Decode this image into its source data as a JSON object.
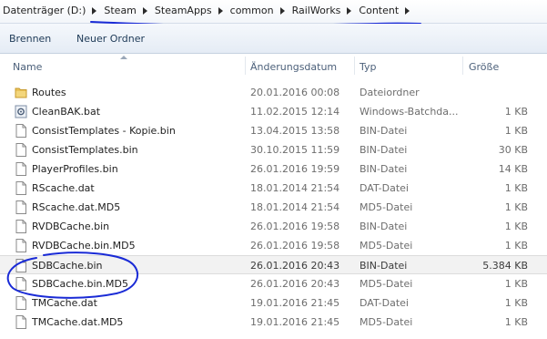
{
  "breadcrumb": {
    "items": [
      {
        "label": "Datenträger (D:)"
      },
      {
        "label": "Steam"
      },
      {
        "label": "SteamApps"
      },
      {
        "label": "common"
      },
      {
        "label": "RailWorks"
      },
      {
        "label": "Content"
      }
    ]
  },
  "toolbar": {
    "burn_label": "Brennen",
    "new_folder_label": "Neuer Ordner"
  },
  "columns": {
    "name": "Name",
    "date": "Änderungsdatum",
    "type": "Typ",
    "size": "Größe"
  },
  "files": [
    {
      "name": "Routes",
      "date": "20.01.2016 00:08",
      "type": "Dateiordner",
      "size": "",
      "icon": "folder-icon"
    },
    {
      "name": "CleanBAK.bat",
      "date": "11.02.2015 12:14",
      "type": "Windows-Batchda...",
      "size": "1 KB",
      "icon": "batch-file-icon"
    },
    {
      "name": "ConsistTemplates - Kopie.bin",
      "date": "13.04.2015 13:58",
      "type": "BIN-Datei",
      "size": "1 KB",
      "icon": "file-icon"
    },
    {
      "name": "ConsistTemplates.bin",
      "date": "30.10.2015 11:59",
      "type": "BIN-Datei",
      "size": "30 KB",
      "icon": "file-icon"
    },
    {
      "name": "PlayerProfiles.bin",
      "date": "26.01.2016 19:59",
      "type": "BIN-Datei",
      "size": "14 KB",
      "icon": "file-icon"
    },
    {
      "name": "RScache.dat",
      "date": "18.01.2014 21:54",
      "type": "DAT-Datei",
      "size": "1 KB",
      "icon": "file-icon"
    },
    {
      "name": "RScache.dat.MD5",
      "date": "18.01.2014 21:54",
      "type": "MD5-Datei",
      "size": "1 KB",
      "icon": "file-icon"
    },
    {
      "name": "RVDBCache.bin",
      "date": "26.01.2016 19:58",
      "type": "BIN-Datei",
      "size": "1 KB",
      "icon": "file-icon"
    },
    {
      "name": "RVDBCache.bin.MD5",
      "date": "26.01.2016 19:58",
      "type": "MD5-Datei",
      "size": "1 KB",
      "icon": "file-icon"
    },
    {
      "name": "SDBCache.bin",
      "date": "26.01.2016 20:43",
      "type": "BIN-Datei",
      "size": "5.384 KB",
      "icon": "file-icon",
      "selected": true
    },
    {
      "name": "SDBCache.bin.MD5",
      "date": "26.01.2016 20:43",
      "type": "MD5-Datei",
      "size": "1 KB",
      "icon": "file-icon"
    },
    {
      "name": "TMCache.dat",
      "date": "19.01.2016 21:45",
      "type": "DAT-Datei",
      "size": "1 KB",
      "icon": "file-icon"
    },
    {
      "name": "TMCache.dat.MD5",
      "date": "19.01.2016 21:45",
      "type": "MD5-Datei",
      "size": "1 KB",
      "icon": "file-icon"
    }
  ],
  "colors": {
    "annotation": "#1a2bd6",
    "selected_row": "#f2f2f2",
    "folder": "#e8c25a"
  }
}
